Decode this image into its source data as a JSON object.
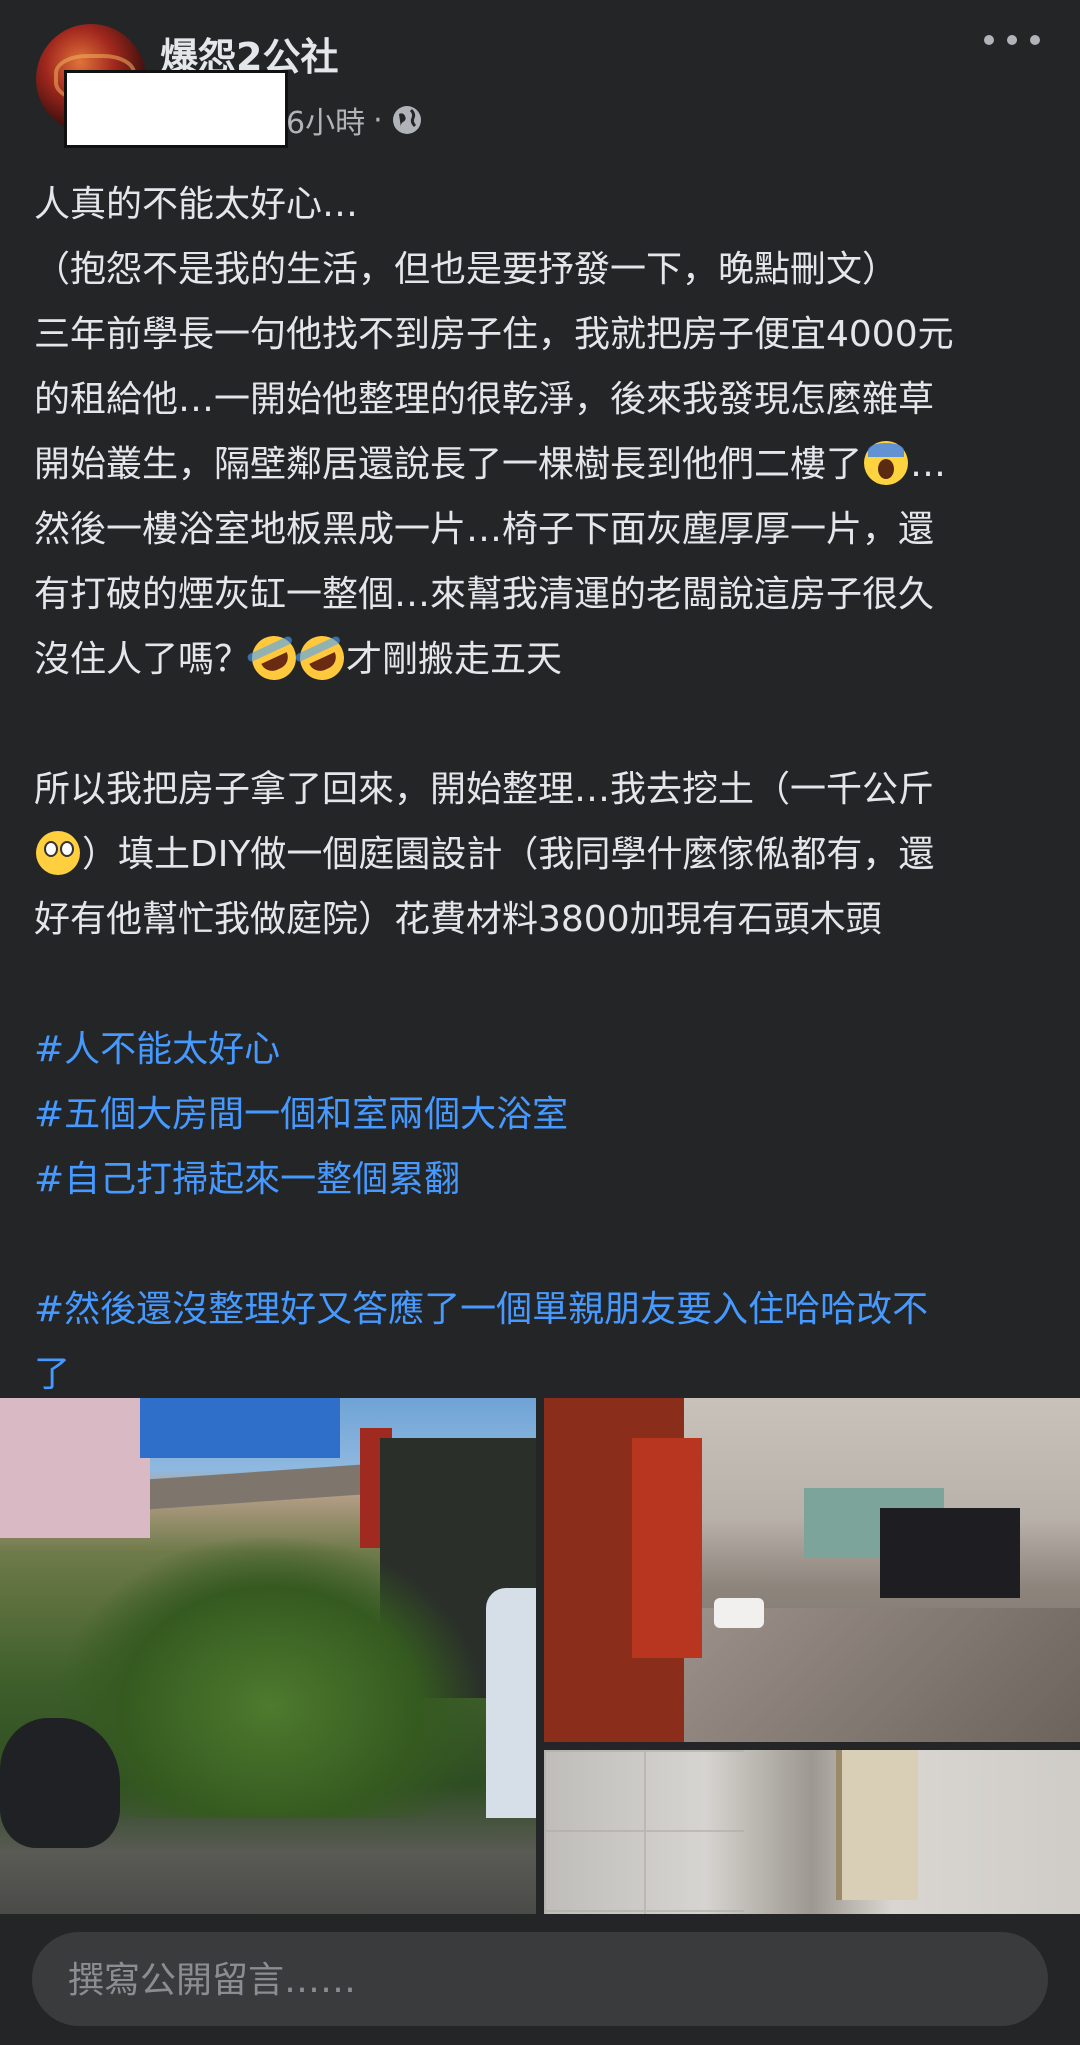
{
  "post": {
    "group_name": "爆怨2公社",
    "time": "6小時",
    "separator": "·",
    "body_lines": [
      "人真的不能太好心…",
      "（抱怨不是我的生活，但也是要抒發一下，晚點刪文）",
      "三年前學長一句他找不到房子住，我就把房子便宜4000元",
      "的租給他…一開始他整理的很乾淨，後來我發現怎麼雜草",
      "開始叢生，隔壁鄰居還說長了一棵樹長到他們二樓了",
      "…",
      "然後一樓浴室地板黑成一片…椅子下面灰塵厚厚一片，還",
      "有打破的煙灰缸一整個…來幫我清運的老闆說這房子很久",
      "沒住人了嗎？",
      "才剛搬走五天",
      "所以我把房子拿了回來，開始整理…我去挖土（一千公斤",
      "）填土DIY做一個庭園設計（我同學什麼傢俬都有，還",
      "好有他幫忙我做庭院）花費材料3800加現有石頭木頭"
    ],
    "hashtags": [
      "#人不能太好心",
      "#五個大房間一個和室兩個大浴室",
      "#自己打掃起來一整個累翻",
      "#然後還沒整理好又答應了一個單親朋友要入住哈哈改不",
      "了"
    ]
  },
  "comment": {
    "placeholder": "撰寫公開留言……"
  },
  "icons": {
    "visibility": "globe-icon",
    "more": "more-options-icon"
  },
  "colors": {
    "background": "#242526",
    "text": "#e4e6eb",
    "secondary_text": "#b0b3b8",
    "hashtag": "#4599ff",
    "input_bg": "#3a3b3c"
  }
}
